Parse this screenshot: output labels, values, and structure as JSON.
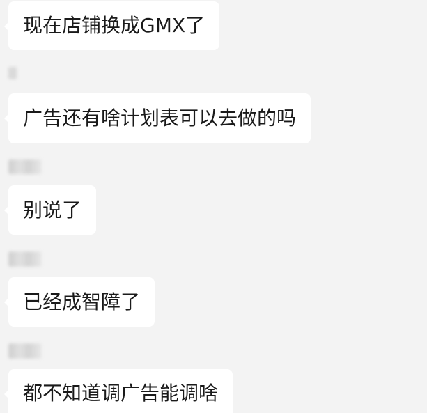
{
  "chat": {
    "messages": [
      {
        "text": "现在店铺换成GMX了"
      },
      {
        "text": "广告还有啥计划表可以去做的吗"
      },
      {
        "text": "别说了"
      },
      {
        "text": "已经成智障了"
      },
      {
        "text": "都不知道调广告能调啥"
      }
    ]
  },
  "colors": {
    "background": "#f3f3f3",
    "bubble": "#ffffff",
    "text": "#1a1a1a"
  }
}
